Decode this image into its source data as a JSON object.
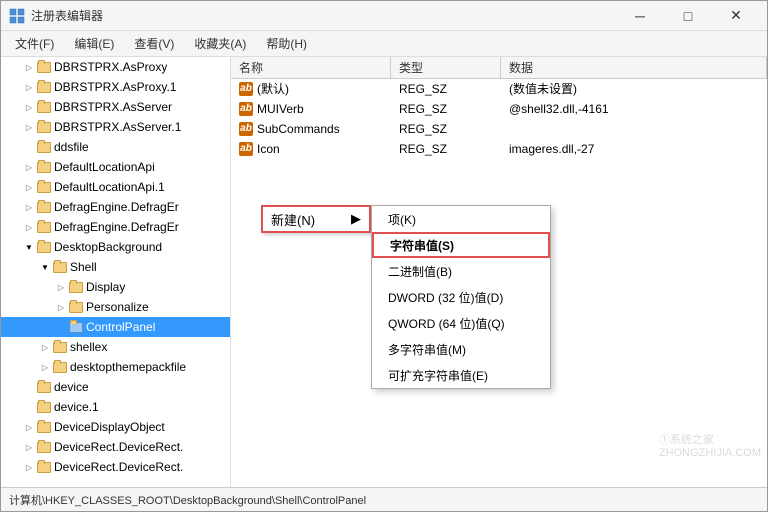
{
  "window": {
    "title": "注册表编辑器",
    "controls": {
      "minimize": "─",
      "maximize": "□",
      "close": "✕"
    }
  },
  "menubar": {
    "items": [
      "文件(F)",
      "编辑(E)",
      "查看(V)",
      "收藏夹(A)",
      "帮助(H)"
    ]
  },
  "tree": {
    "items": [
      {
        "id": "t1",
        "label": "DBRSTPRX.AsProxy",
        "level": 1,
        "expanded": false
      },
      {
        "id": "t2",
        "label": "DBRSTPRX.AsProxy.1",
        "level": 1,
        "expanded": false
      },
      {
        "id": "t3",
        "label": "DBRSTPRX.AsServer",
        "level": 1,
        "expanded": false
      },
      {
        "id": "t4",
        "label": "DBRSTPRX.AsServer.1",
        "level": 1,
        "expanded": false
      },
      {
        "id": "t5",
        "label": "ddsfile",
        "level": 1,
        "expanded": false
      },
      {
        "id": "t6",
        "label": "DefaultLocationApi",
        "level": 1,
        "expanded": false
      },
      {
        "id": "t7",
        "label": "DefaultLocationApi.1",
        "level": 1,
        "expanded": false
      },
      {
        "id": "t8",
        "label": "DefragEngine.DefragEr",
        "level": 1,
        "expanded": false
      },
      {
        "id": "t9",
        "label": "DefragEngine.DefragEr",
        "level": 1,
        "expanded": false
      },
      {
        "id": "t10",
        "label": "DesktopBackground",
        "level": 1,
        "expanded": true
      },
      {
        "id": "t11",
        "label": "Shell",
        "level": 2,
        "expanded": true
      },
      {
        "id": "t12",
        "label": "Display",
        "level": 3,
        "expanded": false
      },
      {
        "id": "t13",
        "label": "Personalize",
        "level": 3,
        "expanded": false
      },
      {
        "id": "t14",
        "label": "ControlPanel",
        "level": 3,
        "selected": true
      },
      {
        "id": "t15",
        "label": "shellex",
        "level": 2,
        "expanded": false
      },
      {
        "id": "t16",
        "label": "desktopthemepackfile",
        "level": 2,
        "expanded": false
      },
      {
        "id": "t17",
        "label": "device",
        "level": 1,
        "expanded": false
      },
      {
        "id": "t18",
        "label": "device.1",
        "level": 1,
        "expanded": false
      },
      {
        "id": "t19",
        "label": "DeviceDisplayObject",
        "level": 1,
        "expanded": false
      },
      {
        "id": "t20",
        "label": "DeviceRect.DeviceRect.",
        "level": 1,
        "expanded": false
      },
      {
        "id": "t21",
        "label": "DeviceRect.DeviceRect.",
        "level": 1,
        "expanded": false
      }
    ]
  },
  "listview": {
    "headers": [
      "名称",
      "类型",
      "数据"
    ],
    "rows": [
      {
        "name": "(默认)",
        "type": "REG_SZ",
        "data": "(数值未设置)"
      },
      {
        "name": "MUIVerb",
        "type": "REG_SZ",
        "data": "@shell32.dll,-4161"
      },
      {
        "name": "SubCommands",
        "type": "REG_SZ",
        "data": ""
      },
      {
        "name": "Icon",
        "type": "REG_SZ",
        "data": "imageres.dll,-27"
      }
    ]
  },
  "context_menu": {
    "new_label": "新建(N)",
    "arrow": "▶",
    "submenu_items": [
      {
        "label": "项(K)",
        "highlighted": false
      },
      {
        "label": "字符串值(S)",
        "highlighted": true
      },
      {
        "label": "二进制值(B)",
        "highlighted": false
      },
      {
        "label": "DWORD (32 位)值(D)",
        "highlighted": false
      },
      {
        "label": "QWORD (64 位)值(Q)",
        "highlighted": false
      },
      {
        "label": "多字符串值(M)",
        "highlighted": false
      },
      {
        "label": "可扩充字符串值(E)",
        "highlighted": false
      }
    ]
  },
  "statusbar": {
    "text": "计算机\\HKEY_CLASSES_ROOT\\DesktopBackground\\Shell\\ControlPanel"
  },
  "watermark": "①系统之家\nZHONGZHIJIA.COM"
}
